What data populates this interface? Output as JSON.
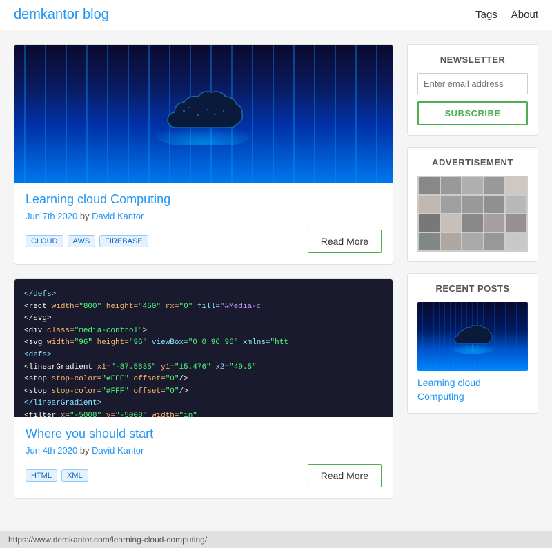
{
  "header": {
    "logo": "demkantor blog",
    "nav": [
      {
        "label": "Tags",
        "href": "#"
      },
      {
        "label": "About",
        "href": "#"
      }
    ]
  },
  "posts": [
    {
      "id": "post-1",
      "title": "Learning cloud Computing",
      "date": "Jun 7th 2020",
      "by": "by",
      "author": "David Kantor",
      "tags": [
        "CLOUD",
        "AWS",
        "FIREBASE"
      ],
      "read_more": "Read More"
    },
    {
      "id": "post-2",
      "title": "Where you should start",
      "date": "Jun 4th 2020",
      "by": "by",
      "author": "David Kantor",
      "tags": [
        "HTML",
        "XML"
      ],
      "read_more": "Read More"
    }
  ],
  "sidebar": {
    "newsletter": {
      "title": "NEWSLETTER",
      "input_placeholder": "Enter email address",
      "subscribe_label": "SUBSCRIBE"
    },
    "advertisement": {
      "title": "ADVERTISEMENT"
    },
    "recent_posts": {
      "title": "RECENT POSTS",
      "items": [
        {
          "title": "Learning cloud Computing"
        }
      ]
    }
  },
  "status_bar": {
    "url": "https://www.demkantor.com/learning-cloud-computing/"
  }
}
